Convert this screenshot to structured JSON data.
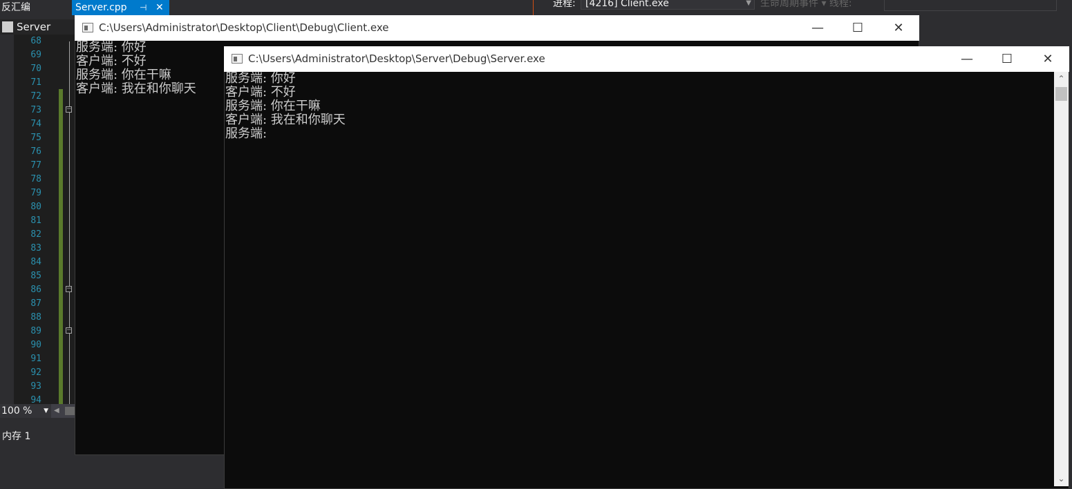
{
  "vs": {
    "tab_disasm": "反汇编",
    "tab_server": "Server.cpp",
    "tab_pin": "⊣",
    "tab_close": "✕",
    "process_label": "进程:",
    "process_value": "[4216] Client.exe",
    "lifecycle_label": "生命周期事件 ▾  线程:",
    "nav_label": "Server",
    "line_numbers": [
      "68",
      "69",
      "70",
      "71",
      "72",
      "73",
      "74",
      "75",
      "76",
      "77",
      "78",
      "79",
      "80",
      "81",
      "82",
      "83",
      "84",
      "85",
      "86",
      "87",
      "88",
      "89",
      "90",
      "91",
      "92",
      "93",
      "94"
    ],
    "zoom": "100 %",
    "memory_label": "内存 1"
  },
  "client": {
    "title": "C:\\Users\\Administrator\\Desktop\\Client\\Debug\\Client.exe",
    "lines": [
      "服务端: 你好",
      "客户端: 不好",
      "服务端: 你在干嘛",
      "客户端: 我在和你聊天"
    ]
  },
  "server": {
    "title": "C:\\Users\\Administrator\\Desktop\\Server\\Debug\\Server.exe",
    "lines": [
      "服务端: 你好",
      "客户端: 不好",
      "服务端: 你在干嘛",
      "客户端: 我在和你聊天",
      "服务端:"
    ]
  },
  "caption_buttons": {
    "minimize": "—",
    "maximize": "☐",
    "close": "✕"
  },
  "colors": {
    "vs_accent": "#007acc",
    "console_bg": "#0c0c0c",
    "console_text": "#cccccc",
    "line_number": "#2b91af",
    "change_bar": "#5a7a2c"
  }
}
